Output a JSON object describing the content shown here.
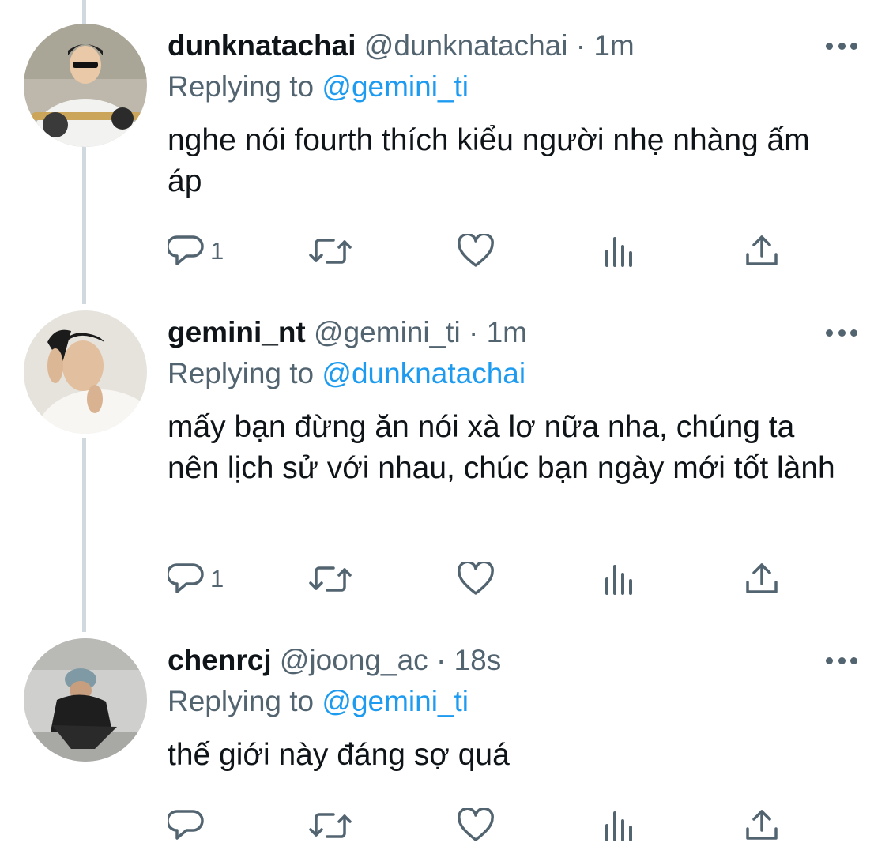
{
  "tweets": [
    {
      "display_name": "dunknatachai",
      "handle": "@dunknatachai",
      "separator": "·",
      "time": "1m",
      "replying_label": "Replying to",
      "replying_to": "@gemini_ti",
      "text": "nghe nói fourth thích kiểu người nhẹ nhàng ấm áp",
      "reply_count": "1"
    },
    {
      "display_name": "gemini_nt",
      "handle": "@gemini_ti",
      "separator": "·",
      "time": "1m",
      "replying_label": "Replying to",
      "replying_to": "@dunknatachai",
      "text": "mấy bạn đừng ăn nói xà lơ nữa nha, chúng ta nên lịch sử với nhau, chúc bạn ngày mới tốt lành",
      "reply_count": "1"
    },
    {
      "display_name": "chenrcj",
      "handle": "@joong_ac",
      "separator": "·",
      "time": "18s",
      "replying_label": "Replying to",
      "replying_to": "@gemini_ti",
      "text": "thế giới này đáng sợ quá",
      "reply_count": ""
    }
  ],
  "icons": {
    "reply": "reply-icon",
    "retweet": "retweet-icon",
    "like": "heart-icon",
    "analytics": "analytics-icon",
    "share": "share-icon",
    "more": "more-icon"
  },
  "colors": {
    "text": "#0f1419",
    "secondary": "#536471",
    "link": "#1d9bf0",
    "thread_line": "#cfd9de"
  }
}
